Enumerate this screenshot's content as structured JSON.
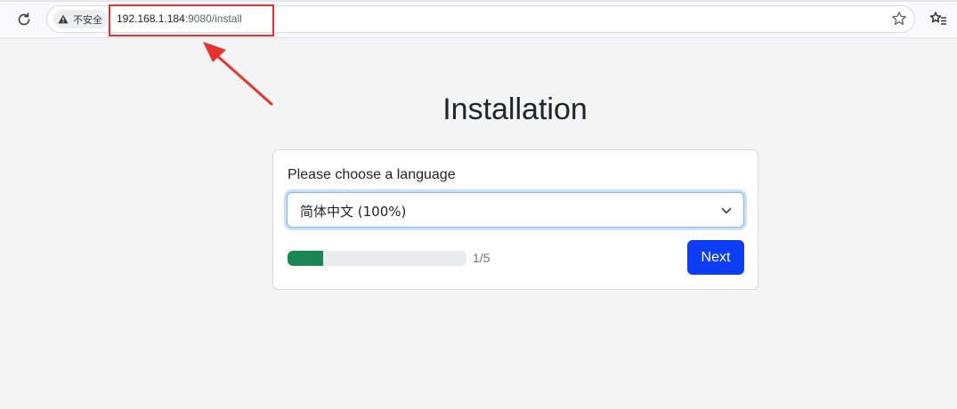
{
  "browser": {
    "security_label": "不安全",
    "url_host": "192.168.1.184",
    "url_rest": ":9080/install"
  },
  "page": {
    "title": "Installation",
    "language_prompt": "Please choose a language",
    "language_selected": "简体中文 (100%)",
    "progress_text": "1/5",
    "progress_fraction": 0.2,
    "next_label": "Next"
  },
  "colors": {
    "accent": "#0d3df5",
    "progress": "#198754",
    "annotation": "#e8322f"
  },
  "icons": [
    "reload-icon",
    "warning-icon",
    "star-icon",
    "favorites-icon",
    "chevron-down-icon"
  ]
}
